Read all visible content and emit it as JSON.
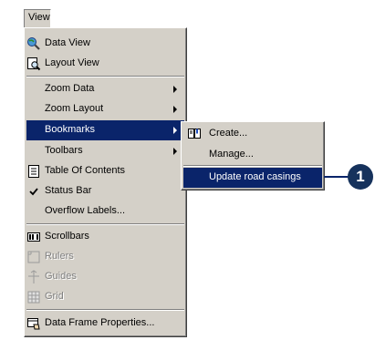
{
  "menubar": {
    "view_menu": "View"
  },
  "view_menu": {
    "items": [
      {
        "label": "Data View"
      },
      {
        "label": "Layout View"
      },
      {
        "label": "Zoom Data"
      },
      {
        "label": "Zoom Layout"
      },
      {
        "label": "Bookmarks"
      },
      {
        "label": "Toolbars"
      },
      {
        "label": "Table Of Contents"
      },
      {
        "label": "Status Bar"
      },
      {
        "label": "Overflow Labels..."
      },
      {
        "label": "Scrollbars"
      },
      {
        "label": "Rulers"
      },
      {
        "label": "Guides"
      },
      {
        "label": "Grid"
      },
      {
        "label": "Data Frame Properties..."
      }
    ]
  },
  "bookmarks_submenu": {
    "items": [
      {
        "label": "Create..."
      },
      {
        "label": "Manage..."
      },
      {
        "label": "Update road casings"
      }
    ]
  },
  "callout": {
    "number": "1"
  },
  "colors": {
    "menu_bg": "#d4d0c8",
    "highlight": "#0a246a",
    "callout": "#16325c"
  }
}
